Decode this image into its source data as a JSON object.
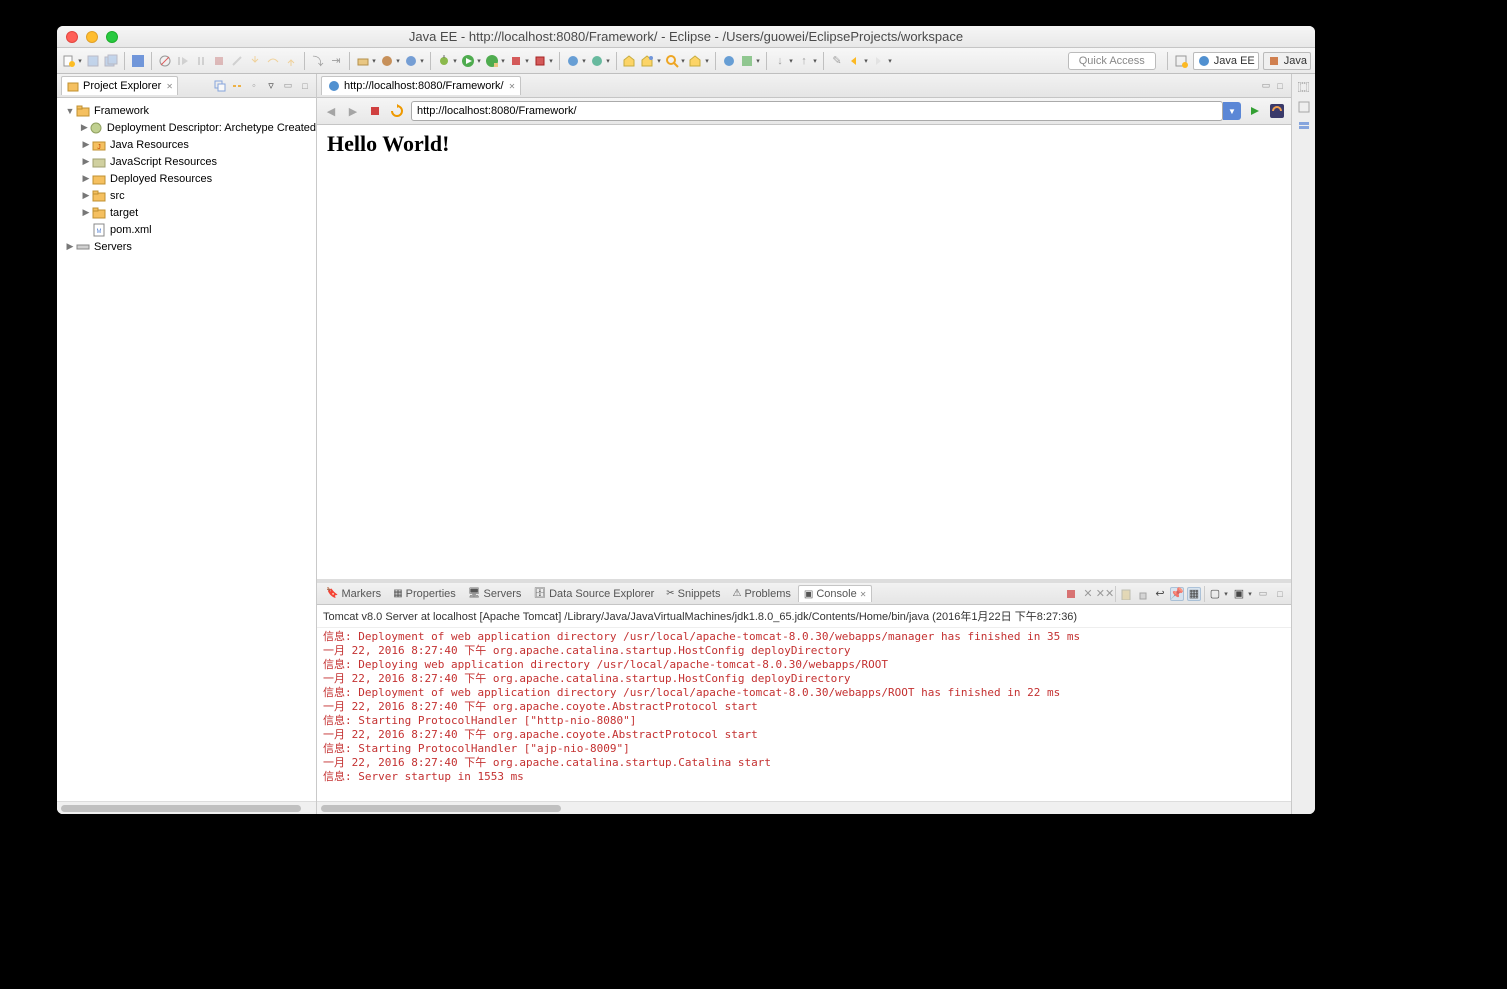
{
  "titlebar": {
    "title": "Java EE - http://localhost:8080/Framework/ - Eclipse - /Users/guowei/EclipseProjects/workspace"
  },
  "toolbar": {
    "quick_access": "Quick Access"
  },
  "perspectives": {
    "javaee": "Java EE",
    "java": "Java"
  },
  "project_explorer": {
    "title": "Project Explorer",
    "tree": [
      {
        "d": 0,
        "a": "▼",
        "i": "proj",
        "t": "Framework"
      },
      {
        "d": 1,
        "a": "▶",
        "i": "dd",
        "t": "Deployment Descriptor: Archetype Created "
      },
      {
        "d": 1,
        "a": "▶",
        "i": "jres",
        "t": "Java Resources"
      },
      {
        "d": 1,
        "a": "▶",
        "i": "jsres",
        "t": "JavaScript Resources"
      },
      {
        "d": 1,
        "a": "▶",
        "i": "dep",
        "t": "Deployed Resources"
      },
      {
        "d": 1,
        "a": "▶",
        "i": "fld",
        "t": "src"
      },
      {
        "d": 1,
        "a": "▶",
        "i": "fld",
        "t": "target"
      },
      {
        "d": 1,
        "a": "",
        "i": "xml",
        "t": "pom.xml"
      },
      {
        "d": 0,
        "a": "▶",
        "i": "srv",
        "t": "Servers"
      }
    ]
  },
  "editor": {
    "tab_url": "http://localhost:8080/Framework/",
    "address": "http://localhost:8080/Framework/",
    "page_heading": "Hello World!"
  },
  "bottom": {
    "tabs": [
      "Markers",
      "Properties",
      "Servers",
      "Data Source Explorer",
      "Snippets",
      "Problems",
      "Console"
    ],
    "active": "Console",
    "description": "Tomcat v8.0 Server at localhost [Apache Tomcat] /Library/Java/JavaVirtualMachines/jdk1.8.0_65.jdk/Contents/Home/bin/java (2016年1月22日 下午8:27:36)",
    "lines": [
      "信息: Deployment of web application directory /usr/local/apache-tomcat-8.0.30/webapps/manager has finished in 35 ms",
      "一月 22, 2016 8:27:40 下午 org.apache.catalina.startup.HostConfig deployDirectory",
      "信息: Deploying web application directory /usr/local/apache-tomcat-8.0.30/webapps/ROOT",
      "一月 22, 2016 8:27:40 下午 org.apache.catalina.startup.HostConfig deployDirectory",
      "信息: Deployment of web application directory /usr/local/apache-tomcat-8.0.30/webapps/ROOT has finished in 22 ms",
      "一月 22, 2016 8:27:40 下午 org.apache.coyote.AbstractProtocol start",
      "信息: Starting ProtocolHandler [\"http-nio-8080\"]",
      "一月 22, 2016 8:27:40 下午 org.apache.coyote.AbstractProtocol start",
      "信息: Starting ProtocolHandler [\"ajp-nio-8009\"]",
      "一月 22, 2016 8:27:40 下午 org.apache.catalina.startup.Catalina start",
      "信息: Server startup in 1553 ms"
    ]
  }
}
